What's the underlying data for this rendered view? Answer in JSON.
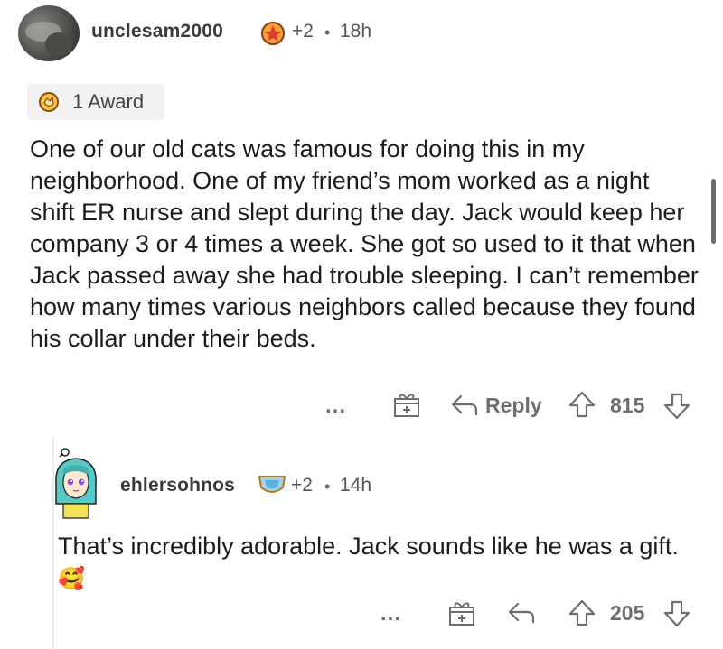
{
  "comment": {
    "username": "unclesam2000",
    "karma_delta": "+2",
    "separator": "•",
    "time": "18h",
    "award_label": "1 Award",
    "body": "One of our old cats was famous for doing this in my neighborhood. One of my friend’s mom worked as a night shift ER nurse and slept during the day. Jack would keep her company 3 or 4 times a week. She got so used to it that when Jack passed away she had trouble sleeping. I can’t remember how many times various neighbors called because they found his collar under their beds.",
    "actions": {
      "more": "...",
      "reply": "Reply",
      "score": "815"
    }
  },
  "reply": {
    "username": "ehlersohnos",
    "karma_delta": "+2",
    "separator": "•",
    "time": "14h",
    "body": "That’s incredibly adorable. Jack sounds like he was a gift.",
    "emoji": "🥰",
    "actions": {
      "more": "...",
      "score": "205"
    }
  },
  "icons": {
    "award": "award-medal-icon",
    "flair": "flair-shield-icon",
    "gift": "gift-icon",
    "reply": "reply-arrow-icon",
    "upvote": "upvote-arrow-icon",
    "downvote": "downvote-arrow-icon"
  },
  "colors": {
    "text": "#1a1a1b",
    "muted": "#6e6e70",
    "award_bg": "#f1f1f1"
  }
}
